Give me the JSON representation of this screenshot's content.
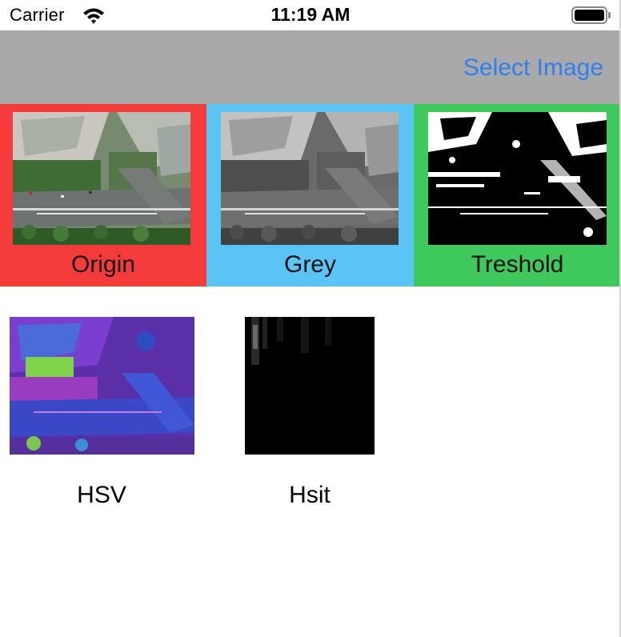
{
  "status_bar": {
    "carrier": "Carrier",
    "time": "11:19 AM",
    "icons": [
      "wifi-icon",
      "battery-icon"
    ]
  },
  "nav": {
    "select_label": "Select Image",
    "accent": "#2f7ff0",
    "background": "#a9a9a9"
  },
  "panels": [
    {
      "label": "Origin",
      "color": "#f53a3a",
      "image": "aerial-street-photo"
    },
    {
      "label": "Grey",
      "color": "#5ac5f5",
      "image": "aerial-street-grayscale"
    },
    {
      "label": "Treshold",
      "color": "#3fc85c",
      "image": "aerial-street-threshold"
    }
  ],
  "results": [
    {
      "label": "HSV",
      "image": "aerial-street-hsv"
    },
    {
      "label": "Hsit",
      "image": "histogram-dark-image"
    }
  ]
}
